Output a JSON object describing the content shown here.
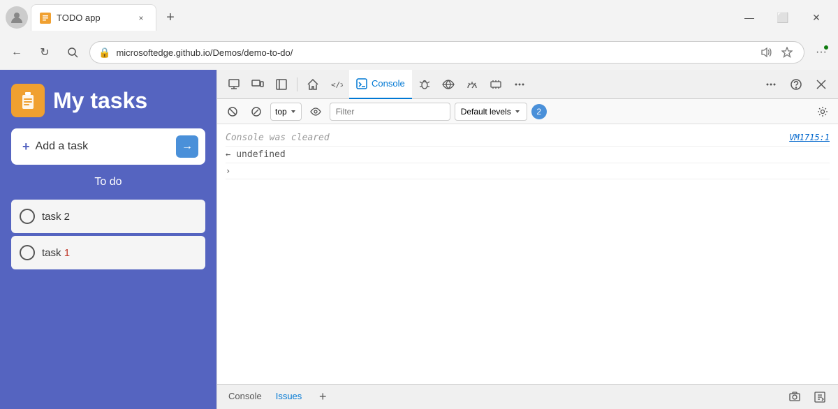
{
  "browser": {
    "title": "TODO app",
    "tab_close": "×",
    "new_tab": "+",
    "win_minimize": "—",
    "win_maximize": "⬜",
    "win_close": "✕",
    "address": "microsoftedge.github.io/Demos/demo-to-do/",
    "back_btn": "←",
    "refresh_btn": "↻",
    "search_btn": "🔍",
    "menu_dots": "···"
  },
  "devtools": {
    "tabs": [
      {
        "id": "inspect",
        "label": "",
        "icon": "⬚"
      },
      {
        "id": "pointer",
        "label": "",
        "icon": "⬛"
      },
      {
        "id": "layout",
        "label": "",
        "icon": "▣"
      },
      {
        "id": "home",
        "label": "",
        "icon": "⌂"
      },
      {
        "id": "code",
        "label": "",
        "icon": "</>"
      },
      {
        "id": "console",
        "label": "Console",
        "icon": "▬",
        "active": true
      },
      {
        "id": "bug",
        "label": "",
        "icon": "🐛"
      },
      {
        "id": "wifi",
        "label": "",
        "icon": "≈"
      },
      {
        "id": "performance",
        "label": "",
        "icon": "⚡"
      },
      {
        "id": "layers",
        "label": "",
        "icon": "▭"
      },
      {
        "id": "more",
        "label": "+",
        "icon": ""
      }
    ],
    "toolbar_more": "···",
    "toolbar_help": "?",
    "toolbar_close": "✕",
    "console_toolbar": {
      "clear_btn": "🚫",
      "filter_btn": "⊘",
      "context_select": "top",
      "eye_btn": "👁",
      "filter_placeholder": "Filter",
      "default_levels": "Default levels",
      "badge_count": "2",
      "settings_btn": "⚙"
    },
    "console_output": [
      {
        "type": "cleared",
        "text": "Console was cleared",
        "link": "VM1715:1"
      },
      {
        "type": "result",
        "arrow": "←",
        "text": "undefined"
      }
    ],
    "bottom_tabs": [
      "Console",
      "Issues"
    ],
    "bottom_add": "+"
  },
  "todo": {
    "title": "My tasks",
    "add_task_label": "Add a task",
    "section_title": "To do",
    "tasks": [
      {
        "name": "task 2"
      },
      {
        "name": "task 1",
        "highlight_char": "1"
      }
    ]
  }
}
